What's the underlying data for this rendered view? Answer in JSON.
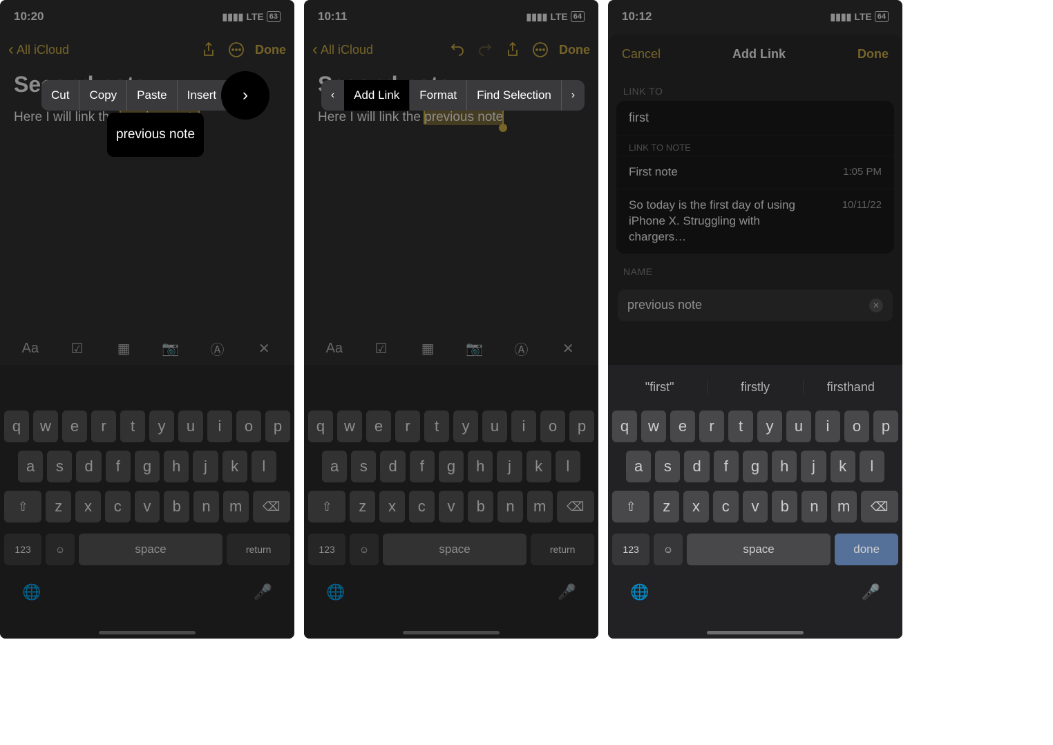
{
  "screen1": {
    "time": "10:20",
    "signal": "LTE",
    "battery": "63",
    "back_label": "All iCloud",
    "done": "Done",
    "note_title": "Second note",
    "body_pre": "Here I will link the ",
    "body_sel": "previous note",
    "ctx": {
      "cut": "Cut",
      "copy": "Copy",
      "paste": "Paste",
      "insert": "Insert"
    },
    "popover_text": "previous note"
  },
  "screen2": {
    "time": "10:11",
    "signal": "LTE",
    "battery": "64",
    "back_label": "All iCloud",
    "done": "Done",
    "note_title": "Second note",
    "body_pre": "Here I will link the ",
    "body_sel": "previous note",
    "ctx": {
      "addlink": "Add Link",
      "format": "Format",
      "find": "Find Selection"
    }
  },
  "screen3": {
    "time": "10:12",
    "signal": "LTE",
    "battery": "64",
    "cancel": "Cancel",
    "title": "Add Link",
    "done": "Done",
    "sections": {
      "link_to": "LINK TO",
      "link_to_note": "LINK TO NOTE",
      "name": "NAME"
    },
    "search_value": "first",
    "results": [
      {
        "title": "First note",
        "time": "1:05 PM"
      },
      {
        "title": "So today is the first day of using iPhone X. Struggling with chargers…",
        "time": "10/11/22"
      }
    ],
    "name_value": "previous note",
    "suggestions": [
      "\"first\"",
      "firstly",
      "firsthand"
    ]
  },
  "keyboard": {
    "row1": [
      "q",
      "w",
      "e",
      "r",
      "t",
      "y",
      "u",
      "i",
      "o",
      "p"
    ],
    "row2": [
      "a",
      "s",
      "d",
      "f",
      "g",
      "h",
      "j",
      "k",
      "l"
    ],
    "row3": [
      "z",
      "x",
      "c",
      "v",
      "b",
      "n",
      "m"
    ],
    "numbers": "123",
    "space": "space",
    "ret": "return",
    "done": "done"
  }
}
